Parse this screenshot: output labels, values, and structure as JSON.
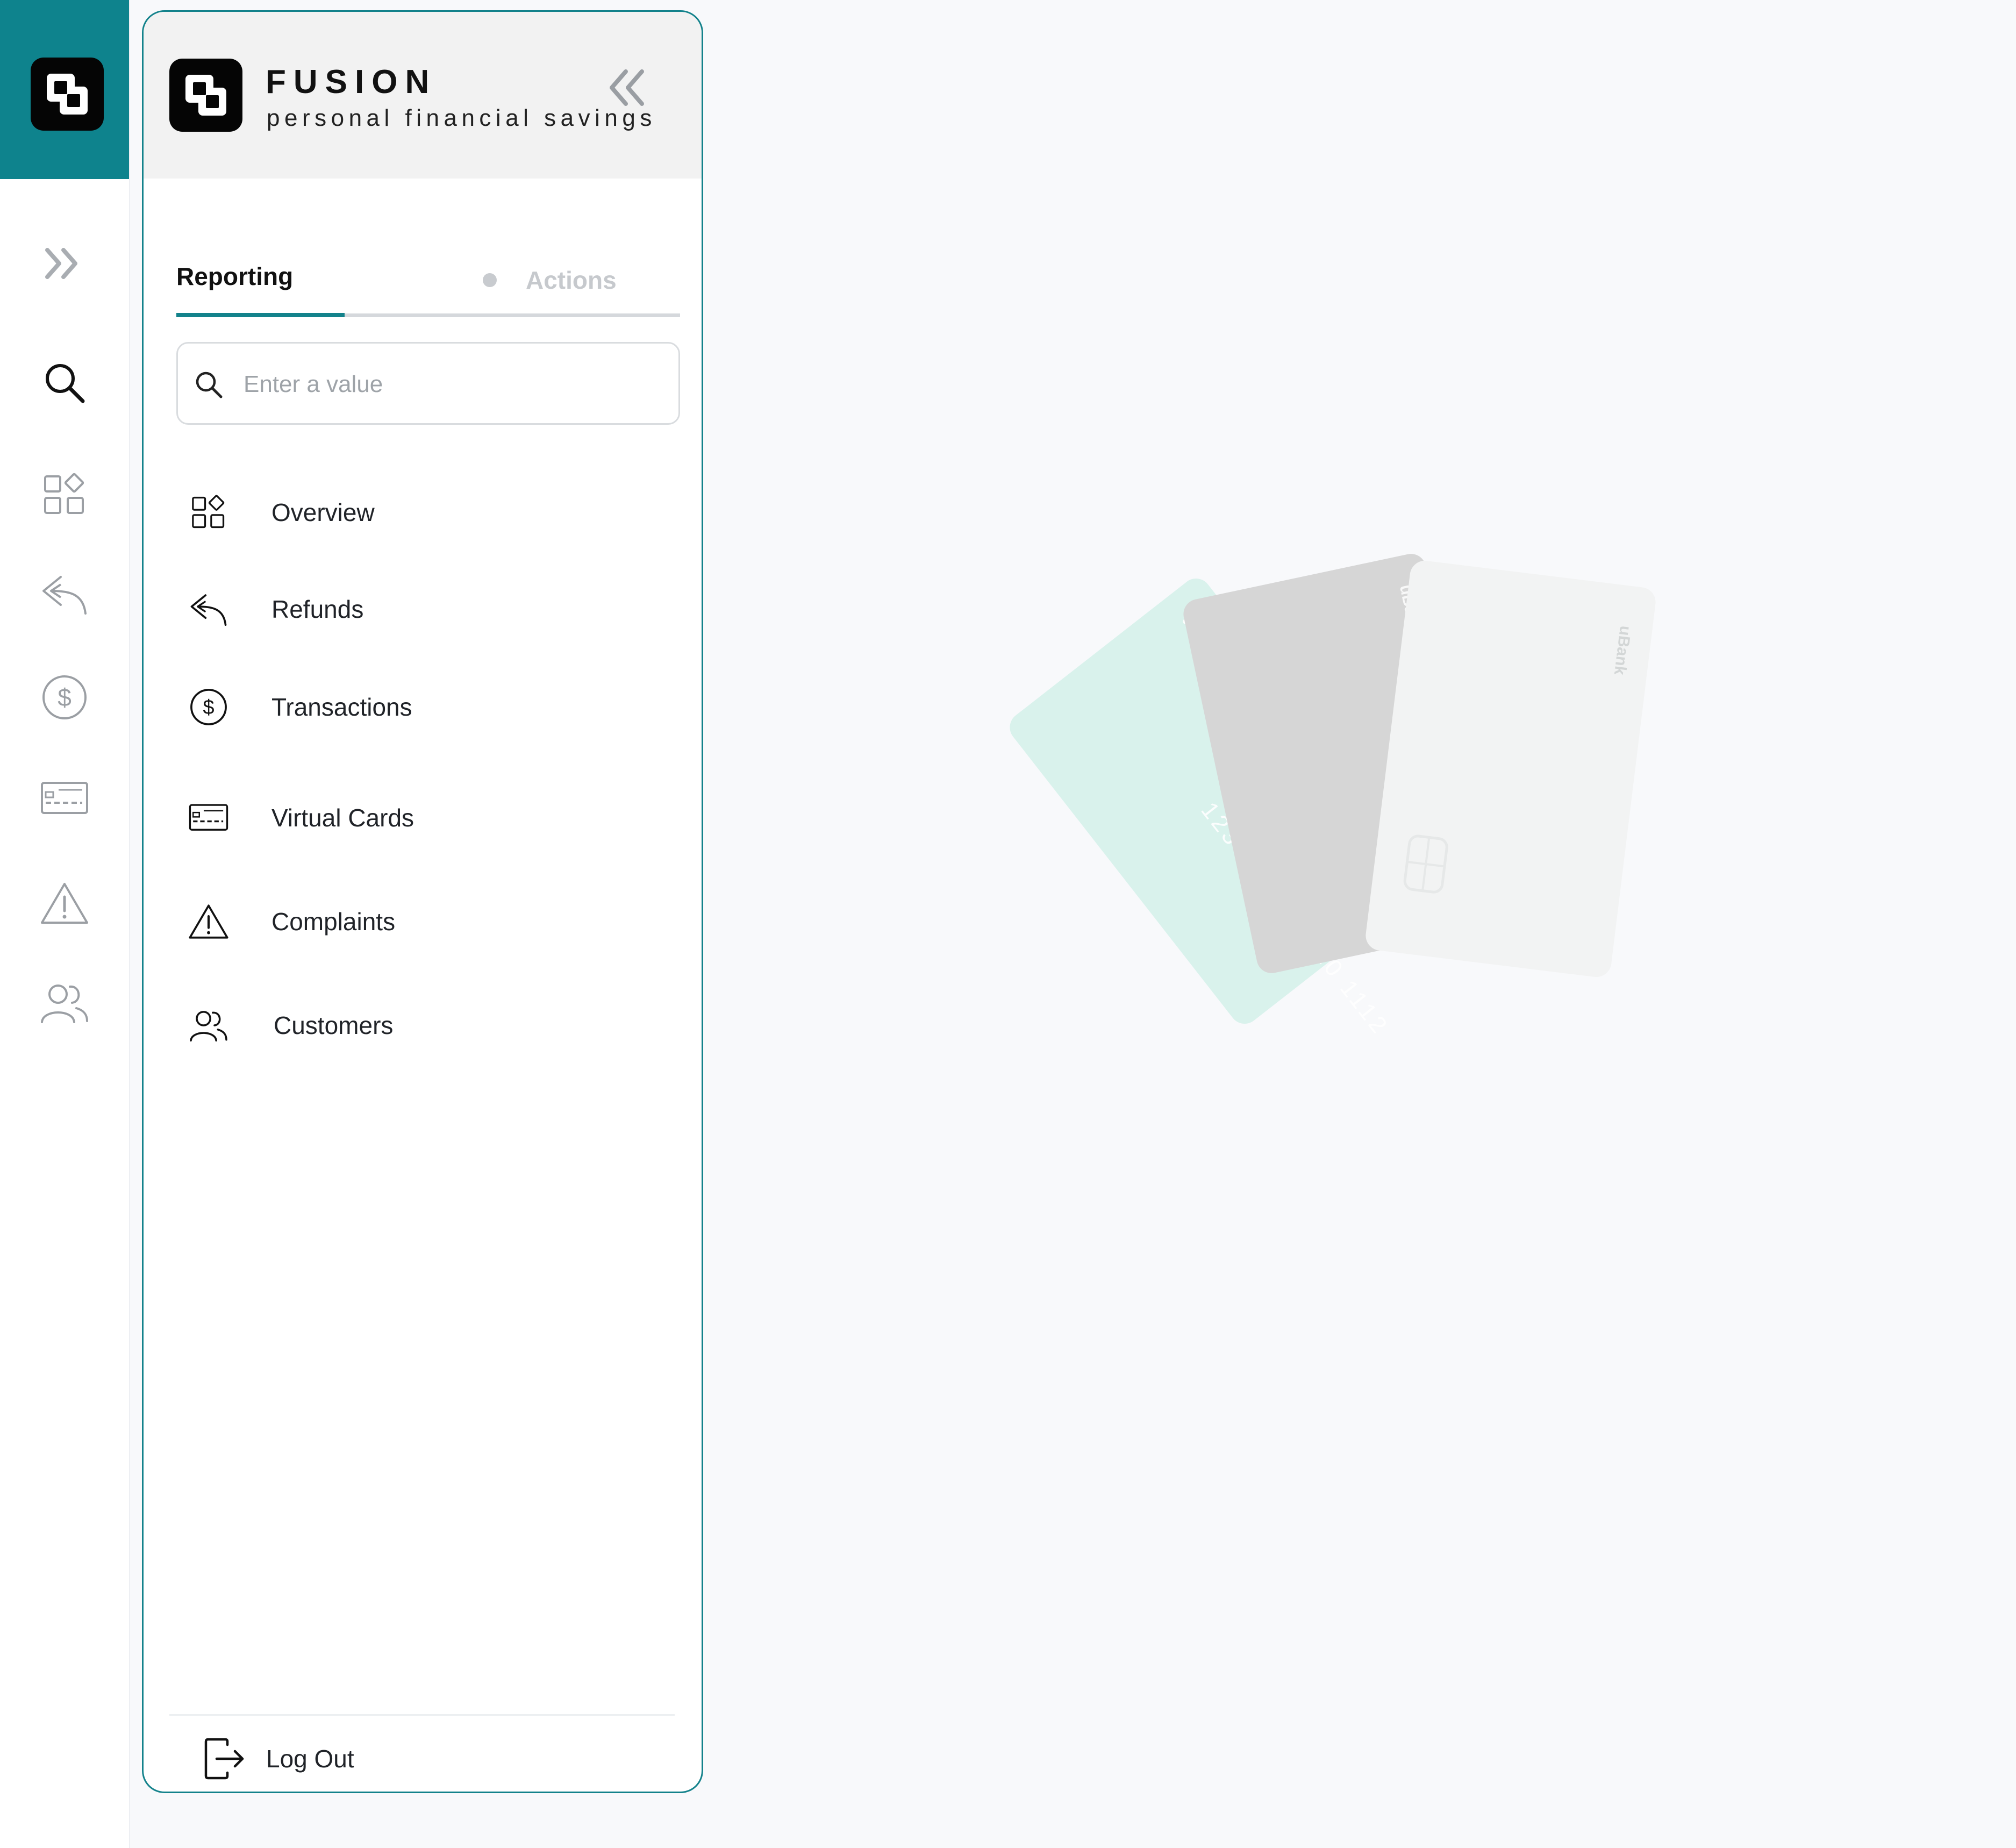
{
  "brand": {
    "name": "FUSION",
    "tagline": "personal financial  savings"
  },
  "tabs": [
    {
      "label": "Reporting",
      "active": true
    },
    {
      "label": "Actions",
      "active": false
    }
  ],
  "search": {
    "placeholder": "Enter a value",
    "value": ""
  },
  "menu": [
    {
      "label": "Overview",
      "icon": "grid-icon"
    },
    {
      "label": "Refunds",
      "icon": "reply-arrow-icon"
    },
    {
      "label": "Transactions",
      "icon": "dollar-circle-icon"
    },
    {
      "label": "Virtual Cards",
      "icon": "card-icon"
    },
    {
      "label": "Complaints",
      "icon": "warning-icon"
    },
    {
      "label": "Customers",
      "icon": "users-icon"
    }
  ],
  "logout": {
    "label": "Log Out",
    "icon": "logout-icon"
  },
  "illustration": {
    "card_number": "1234 4567 8910 1112",
    "card_brand": "uBank"
  },
  "colors": {
    "accent": "#13828b",
    "rail_top": "#0e838d",
    "header_bg": "#f2f2f2",
    "page_bg": "#f8f9fb",
    "card_mint": "#d9f2ec",
    "card_grey": "#d6d6d6",
    "card_white": "#f2f3f3"
  }
}
